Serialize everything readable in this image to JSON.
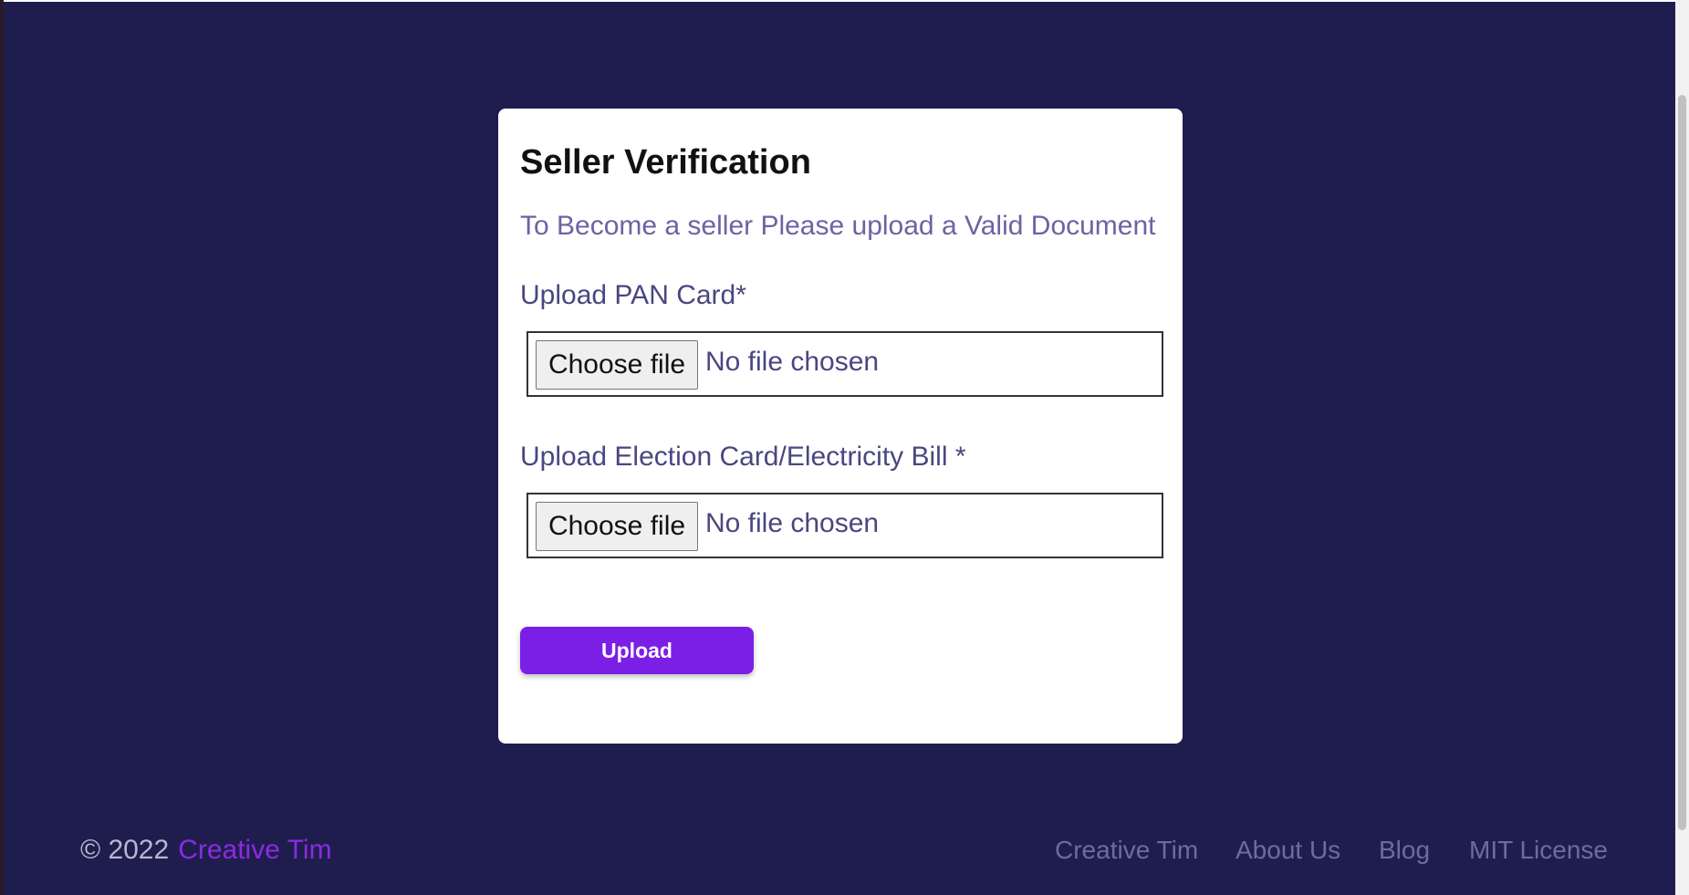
{
  "card": {
    "title": "Seller Verification",
    "subtitle": "To Become a seller Please upload a Valid Document",
    "fields": [
      {
        "label": "Upload PAN Card*",
        "button_label": "Choose file",
        "status": "No file chosen"
      },
      {
        "label": "Upload Election Card/Electricity Bill *",
        "button_label": "Choose file",
        "status": "No file chosen"
      }
    ],
    "submit_label": "Upload"
  },
  "footer": {
    "copyright": "© 2022",
    "brand": "Creative Tim",
    "links": [
      "Creative Tim",
      "About Us",
      "Blog",
      "MIT License"
    ]
  },
  "colors": {
    "background": "#1f1d4e",
    "accent": "#7b1fe6",
    "card": "#ffffff"
  }
}
